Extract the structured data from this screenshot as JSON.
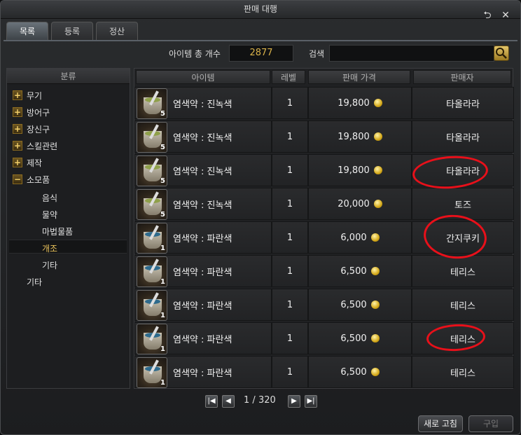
{
  "window": {
    "title": "판매 대행"
  },
  "tabs": [
    {
      "label": "목록"
    },
    {
      "label": "등록"
    },
    {
      "label": "정산"
    }
  ],
  "toolbar": {
    "count_label": "아이템 총 개수",
    "count_value": "2877",
    "search_label": "검색",
    "search_value": ""
  },
  "sidebar": {
    "header": "분류",
    "categories": [
      {
        "label": "무기"
      },
      {
        "label": "방어구"
      },
      {
        "label": "장신구"
      },
      {
        "label": "스킬관련"
      },
      {
        "label": "제작"
      },
      {
        "label": "소모품"
      }
    ],
    "subcategories": [
      {
        "label": "음식"
      },
      {
        "label": "물약"
      },
      {
        "label": "마법물품"
      },
      {
        "label": "개조"
      },
      {
        "label": "기타"
      }
    ],
    "other": "기타"
  },
  "columns": {
    "item": "아이템",
    "level": "레벨",
    "price": "판매 가격",
    "seller": "판매자"
  },
  "rows": [
    {
      "dye": "#8fa04a",
      "qty": "5",
      "name": "염색약 : 진녹색",
      "level": "1",
      "price": "19,800",
      "seller": "타올라라"
    },
    {
      "dye": "#8fa04a",
      "qty": "5",
      "name": "염색약 : 진녹색",
      "level": "1",
      "price": "19,800",
      "seller": "타올라라"
    },
    {
      "dye": "#8fa04a",
      "qty": "5",
      "name": "염색약 : 진녹색",
      "level": "1",
      "price": "19,800",
      "seller": "타올라라"
    },
    {
      "dye": "#8fa04a",
      "qty": "5",
      "name": "염색약 : 진녹색",
      "level": "1",
      "price": "20,000",
      "seller": "토즈"
    },
    {
      "dye": "#2e6a8c",
      "qty": "1",
      "name": "염색약 : 파란색",
      "level": "1",
      "price": "6,000",
      "seller": "간지쿠키"
    },
    {
      "dye": "#2e6a8c",
      "qty": "1",
      "name": "염색약 : 파란색",
      "level": "1",
      "price": "6,500",
      "seller": "테리스"
    },
    {
      "dye": "#2e6a8c",
      "qty": "1",
      "name": "염색약 : 파란색",
      "level": "1",
      "price": "6,500",
      "seller": "테리스"
    },
    {
      "dye": "#2e6a8c",
      "qty": "1",
      "name": "염색약 : 파란색",
      "level": "1",
      "price": "6,500",
      "seller": "테리스"
    },
    {
      "dye": "#2e6a8c",
      "qty": "1",
      "name": "염색약 : 파란색",
      "level": "1",
      "price": "6,500",
      "seller": "테리스"
    }
  ],
  "pager": {
    "current": "1",
    "separator": "/",
    "total": "320"
  },
  "buttons": {
    "refresh": "새로 고침",
    "buy": "구입"
  },
  "colors": {
    "accent_gold": "#d9b24a",
    "annotation_red": "#e8101a"
  }
}
